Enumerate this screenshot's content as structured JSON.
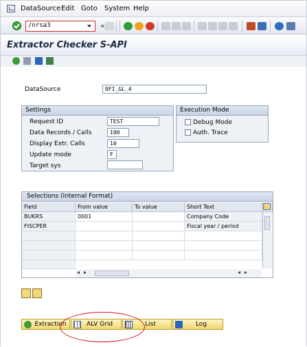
{
  "menu": [
    "DataSource",
    "Edit",
    "Goto",
    "System",
    "Help"
  ],
  "command_field": {
    "value": "/nrsa3"
  },
  "title": "Extractor Checker S-API",
  "datasource": {
    "label": "DataSource",
    "value": "0FI_GL_4"
  },
  "settings": {
    "title": "Settings",
    "request_id": {
      "label": "Request ID",
      "value": "TEST"
    },
    "data_records": {
      "label": "Data Records / Calls",
      "value": "100"
    },
    "display_calls": {
      "label": "Display Extr. Calls",
      "value": "10"
    },
    "update_mode": {
      "label": "Update mode",
      "value": "F"
    },
    "target_sys": {
      "label": "Target sys",
      "value": ""
    }
  },
  "execution_mode": {
    "title": "Execution Mode",
    "debug_mode": {
      "label": "Debug Mode",
      "checked": false
    },
    "auth_trace": {
      "label": "Auth. Trace",
      "checked": false
    }
  },
  "selections": {
    "title": "Selections (Internal Format)",
    "columns": [
      "Field",
      "From value",
      "To value",
      "Short Text"
    ],
    "rows": [
      {
        "field": "BUKRS",
        "from": "0001",
        "to": "",
        "text": "Company Code"
      },
      {
        "field": "FISCPER",
        "from": "",
        "to": "",
        "text": "Fiscal year / period"
      }
    ]
  },
  "buttons": {
    "extraction": "Extraction",
    "alv_grid": "ALV Grid",
    "list": "List",
    "log": "Log"
  },
  "colors": {
    "button_fill": "#f1d76a",
    "highlight_ellipse": "#d0141a"
  }
}
